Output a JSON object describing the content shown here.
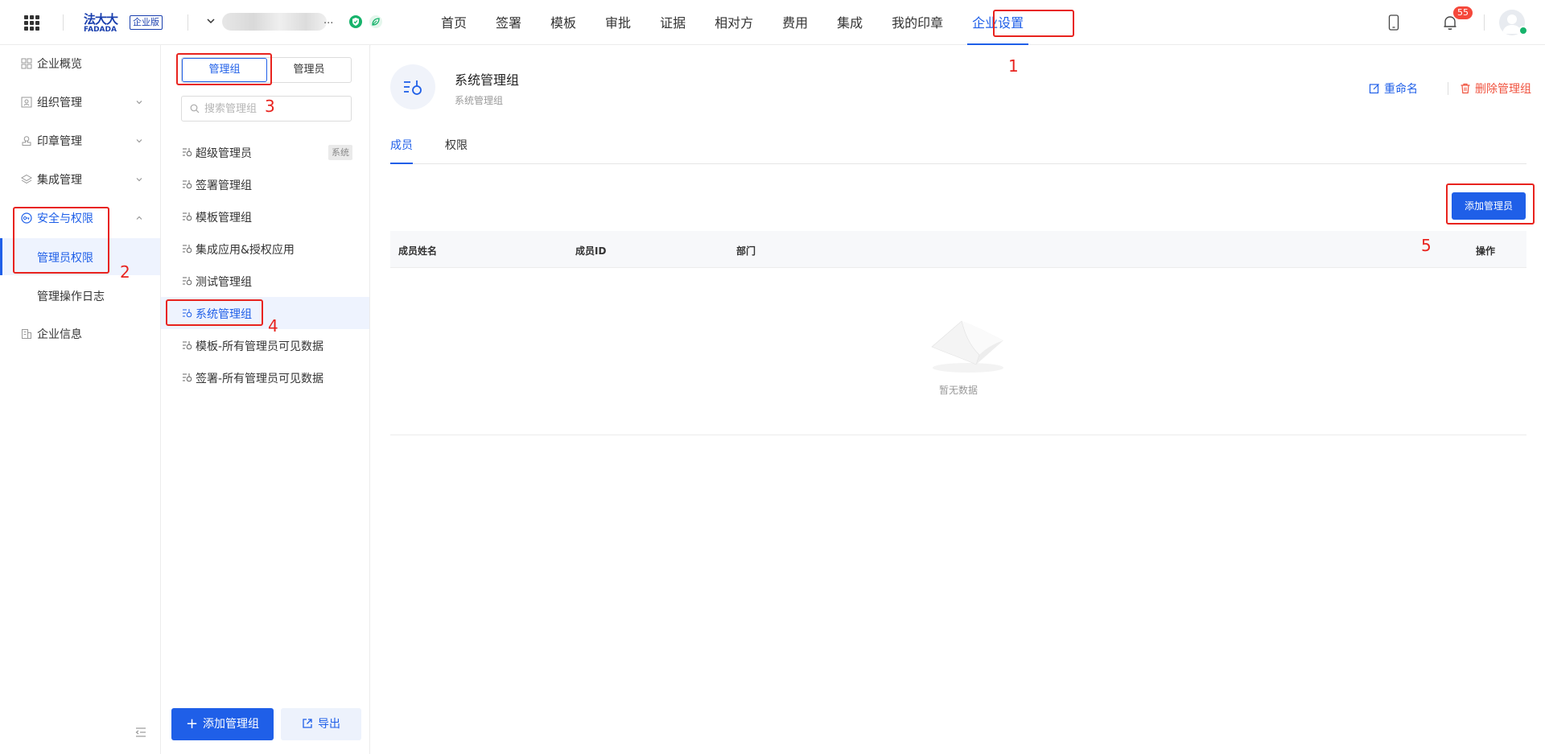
{
  "header": {
    "logo_zh": "法大大",
    "logo_en": "FADADA",
    "edition": "企业版",
    "company_ellipsis": "...",
    "nav": [
      "首页",
      "签署",
      "模板",
      "审批",
      "证据",
      "相对方",
      "费用",
      "集成",
      "我的印章",
      "企业设置"
    ],
    "active_nav": "企业设置",
    "notification_count": "55"
  },
  "sidebar": {
    "items": [
      {
        "label": "企业概览",
        "icon": "overview-icon"
      },
      {
        "label": "组织管理",
        "icon": "org-icon"
      },
      {
        "label": "印章管理",
        "icon": "seal-icon"
      },
      {
        "label": "集成管理",
        "icon": "layers-icon"
      },
      {
        "label": "安全与权限",
        "icon": "security-icon"
      },
      {
        "label": "企业信息",
        "icon": "building-icon"
      }
    ],
    "sub_items": [
      "管理员权限",
      "管理操作日志"
    ],
    "active_sub": "管理员权限"
  },
  "group_panel": {
    "segments": [
      "管理组",
      "管理员"
    ],
    "active_segment": "管理组",
    "search_placeholder": "搜索管理组",
    "groups": [
      {
        "label": "超级管理员",
        "tag": "系统"
      },
      {
        "label": "签署管理组"
      },
      {
        "label": "模板管理组"
      },
      {
        "label": "集成应用&授权应用"
      },
      {
        "label": "测试管理组"
      },
      {
        "label": "系统管理组"
      },
      {
        "label": "模板-所有管理员可见数据"
      },
      {
        "label": "签署-所有管理员可见数据"
      }
    ],
    "active_group": "系统管理组",
    "add_group_label": "添加管理组",
    "export_label": "导出"
  },
  "detail": {
    "group_name": "系统管理组",
    "group_desc": "系统管理组",
    "rename_label": "重命名",
    "delete_label": "删除管理组",
    "tabs": [
      "成员",
      "权限"
    ],
    "active_tab": "成员",
    "add_admin_label": "添加管理员",
    "columns": [
      "成员姓名",
      "成员ID",
      "部门",
      "操作"
    ],
    "rows": [],
    "empty_text": "暂无数据"
  },
  "annotations": [
    "1",
    "2",
    "3",
    "4",
    "5"
  ],
  "colors": {
    "primary": "#1f5fe8",
    "annotation_red": "#e8231e",
    "danger": "#f0533f",
    "badge_red": "#f5483b",
    "verify_green": "#16b36b"
  }
}
